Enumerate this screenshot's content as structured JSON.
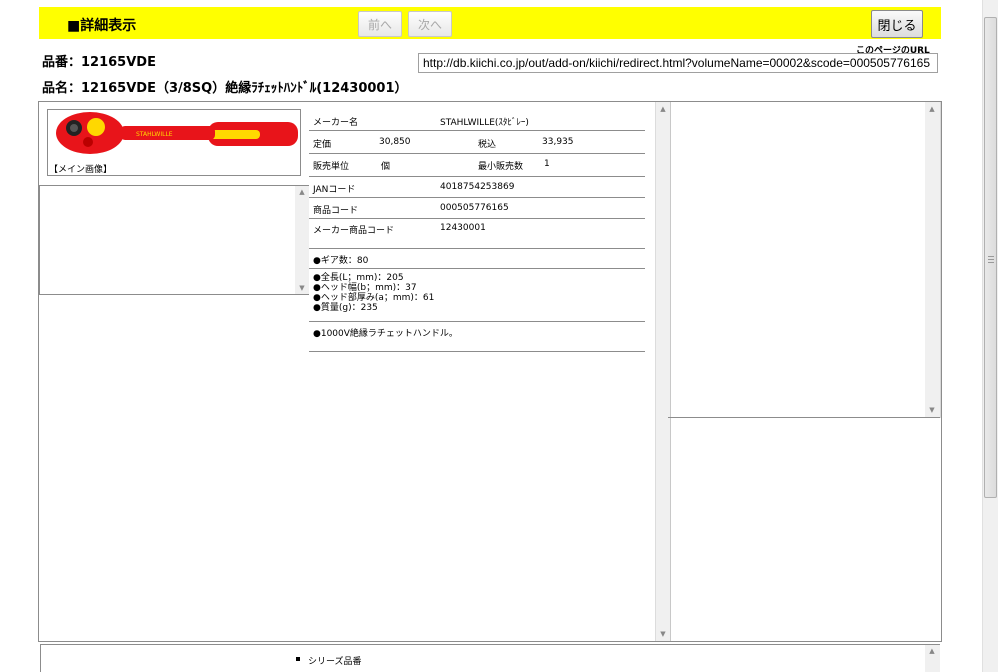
{
  "header": {
    "title": "■詳細表示",
    "prev_label": "前へ",
    "next_label": "次へ",
    "close_label": "閉じる"
  },
  "product": {
    "hinban": "品番：12165VDE",
    "hinmei": "品名：12165VDE（3/8SQ）絶縁ﾗﾁｪｯﾄﾊﾝﾄﾞﾙ(12430001）"
  },
  "url": {
    "label": "このページのURL",
    "value": "http://db.kiichi.co.jp/out/add-on/kiichi/redirect.html?volumeName=00002&scode=000505776165"
  },
  "image": {
    "caption": "【メイン画像】"
  },
  "details": {
    "maker_label": "メーカー名",
    "maker_value": "STAHLWILLE(ｽﾀﾋﾞﾚｰ)",
    "list_price_label": "定価",
    "list_price_value": "30,850",
    "tax_in_label": "税込",
    "tax_in_value": "33,935",
    "unit_label": "販売単位",
    "unit_value": "個",
    "min_qty_label": "最小販売数",
    "min_qty_value": "1",
    "jan_label": "JANコード",
    "jan_value": "4018754253869",
    "code_label": "商品コード",
    "code_value": "000505776165",
    "maker_code_label": "メーカー商品コード",
    "maker_code_value": "12430001",
    "gear": "●ギア数：80",
    "spec1": "●全長(L；mm)：205",
    "spec2": "●ヘッド幅(b；mm)：37",
    "spec3": "●ヘッド部厚み(a；mm)：61",
    "spec4": "●質量(g)：235",
    "note": "●1000V絶縁ラチェットハンドル。"
  },
  "bottom": {
    "series_label": "シリーズ品番"
  },
  "colors": {
    "header_bg": "#ffff00",
    "handle_red": "#e8141a",
    "handle_yellow": "#ffd800"
  }
}
